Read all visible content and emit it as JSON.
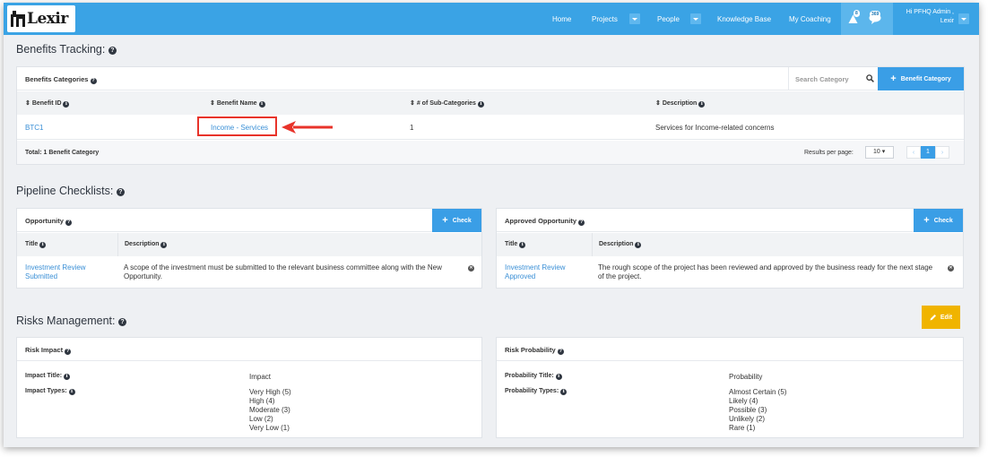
{
  "header": {
    "logo_text": "Lexir",
    "nav": {
      "home": "Home",
      "projects": "Projects",
      "people": "People",
      "knowledge_base": "Knowledge Base",
      "my_coaching": "My Coaching"
    },
    "alerts_badge": "8",
    "messages_badge": "369",
    "user_greeting": "Hi PFHQ Admin ,",
    "user_org": "Lexir"
  },
  "benefits": {
    "section_title": "Benefits Tracking:",
    "panel_title": "Benefits Categories",
    "search_placeholder": "Search Category",
    "add_button": "Benefit Category",
    "columns": {
      "id": "Benefit ID",
      "name": "Benefit Name",
      "subcats": "# of Sub-Categories",
      "description": "Description"
    },
    "rows": [
      {
        "id": "BTC1",
        "name": "Income - Services",
        "subcats": "1",
        "description": "Services for Income-related concerns"
      }
    ],
    "total": "Total: 1 Benefit Category",
    "results_label": "Results per page:",
    "per_page": "10",
    "page": "1"
  },
  "pipeline": {
    "section_title": "Pipeline Checklists:",
    "opportunity": {
      "title": "Opportunity",
      "button": "Check",
      "col_title": "Title",
      "col_description": "Description",
      "item_title": "Investment Review Submitted",
      "item_description": "A scope of the investment must be submitted to the relevant business committee along with the New Opportunity."
    },
    "approved": {
      "title": "Approved Opportunity",
      "button": "Check",
      "col_title": "Title",
      "col_description": "Description",
      "item_title": "Investment Review Approved",
      "item_description": "The rough scope of the project has been reviewed and approved by the business ready for the next stage of the project."
    }
  },
  "risks": {
    "section_title": "Risks Management:",
    "edit_button": "Edit",
    "impact": {
      "title": "Risk Impact",
      "title_label": "Impact Title:",
      "title_value": "Impact",
      "types_label": "Impact Types:",
      "types": [
        "Very High (5)",
        "High (4)",
        "Moderate (3)",
        "Low (2)",
        "Very Low (1)"
      ]
    },
    "probability": {
      "title": "Risk Probability",
      "title_label": "Probability Title:",
      "title_value": "Probability",
      "types_label": "Probability Types:",
      "types": [
        "Almost Certain (5)",
        "Likely (4)",
        "Possible (3)",
        "Unlikely (2)",
        "Rare (1)"
      ]
    }
  },
  "colors": {
    "topbar": "#3aa3e5",
    "accent_blue": "#3a9ee6",
    "link": "#3a8fd6",
    "edit_button": "#f0b400",
    "highlight_red": "#e8332a"
  }
}
